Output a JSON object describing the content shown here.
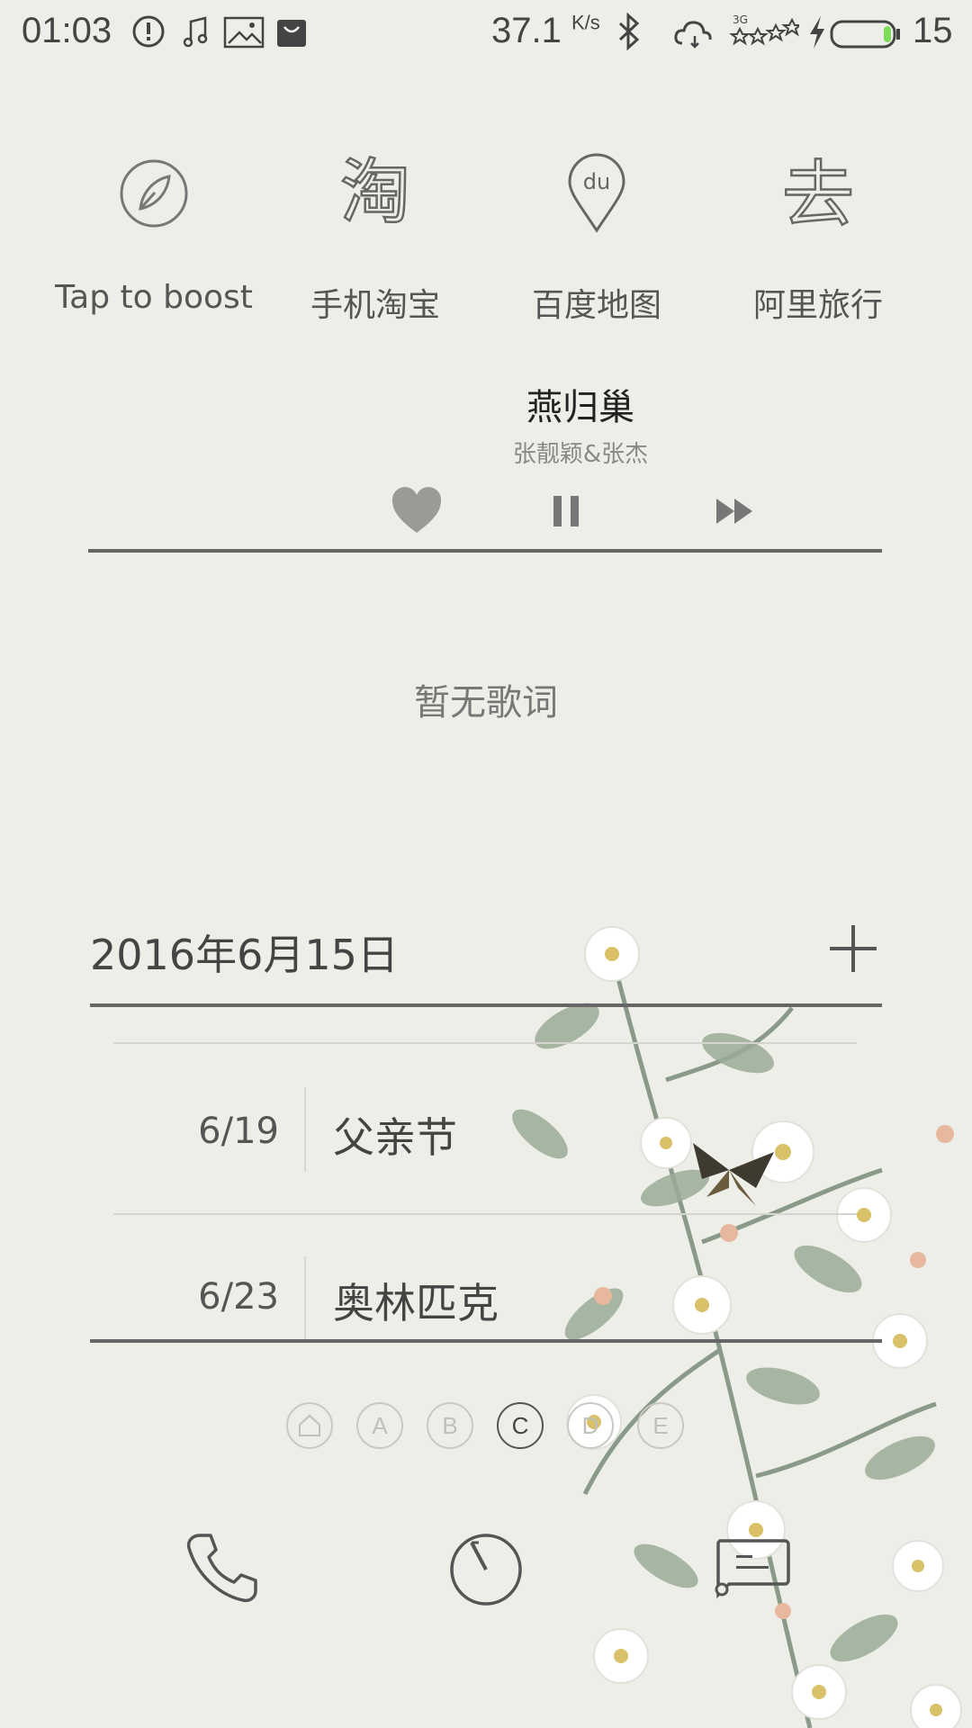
{
  "status_bar": {
    "time": "01:03",
    "net_speed": "37.1",
    "net_unit": "K/s",
    "battery": "15",
    "network": "3G",
    "icons": [
      "alert-icon",
      "music-note-icon",
      "image-icon",
      "shopping-bag-icon",
      "bluetooth-icon",
      "cloud-sync-icon",
      "signal-icon",
      "charging-icon",
      "battery-icon"
    ]
  },
  "shortcuts": [
    {
      "label": "Tap to boost",
      "icon": "rocket-boost-icon"
    },
    {
      "label": "手机淘宝",
      "icon": "taobao-icon"
    },
    {
      "label": "百度地图",
      "icon": "baidu-map-icon"
    },
    {
      "label": "阿里旅行",
      "icon": "ali-travel-icon"
    }
  ],
  "music": {
    "title": "燕归巢",
    "artist": "张靓颖&张杰",
    "lyrics": "暂无歌词",
    "controls": [
      "heart-icon",
      "pause-icon",
      "fast-forward-icon"
    ]
  },
  "calendar": {
    "date": "2016年6月15日",
    "events": [
      {
        "date": "6/19",
        "name": "父亲节"
      },
      {
        "date": "6/23",
        "name": "奥林匹克"
      }
    ]
  },
  "pages": {
    "items": [
      "home-icon",
      "A",
      "B",
      "C",
      "D",
      "E"
    ],
    "active": "C"
  },
  "dock": [
    "phone-icon",
    "speedometer-icon",
    "message-icon"
  ],
  "colors": {
    "background": "#eeeee8",
    "text": "#555555",
    "accent_line": "#666666",
    "battery_green": "#7ddc5a"
  }
}
